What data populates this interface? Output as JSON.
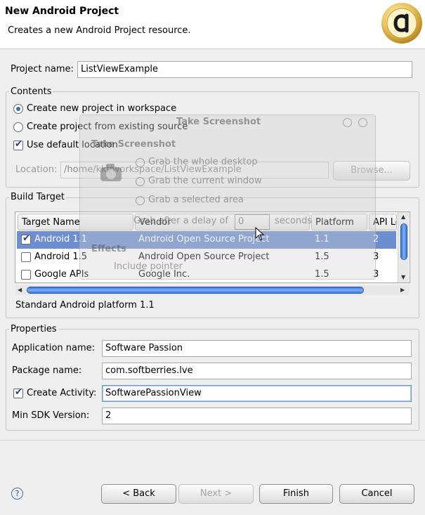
{
  "header": {
    "title": "New Android Project",
    "description": "Creates a new Android Project resource."
  },
  "project_name": {
    "label": "Project name:",
    "value": "ListViewExample"
  },
  "contents": {
    "title": "Contents",
    "create_new": "Create new project in workspace",
    "create_existing": "Create project from existing source",
    "use_default_location": "Use default location",
    "location_label": "Location:",
    "location_value": "/home/kkl/workspace/ListViewExample",
    "browse_label": "Browse..."
  },
  "build_target": {
    "title": "Build Target",
    "columns": [
      "Target Name",
      "Vendor",
      "Platform",
      "API Le"
    ],
    "rows": [
      {
        "checked": true,
        "selected": true,
        "name": "Android 1.1",
        "vendor": "Android Open Source Project",
        "platform": "1.1",
        "api": "2"
      },
      {
        "checked": false,
        "selected": false,
        "name": "Android 1.5",
        "vendor": "Android Open Source Project",
        "platform": "1.5",
        "api": "3"
      },
      {
        "checked": false,
        "selected": false,
        "name": "Google APIs",
        "vendor": "Google Inc.",
        "platform": "1.5",
        "api": "3"
      }
    ],
    "description": "Standard Android platform 1.1"
  },
  "properties": {
    "title": "Properties",
    "app_name_label": "Application name:",
    "app_name_value": "Software Passion",
    "package_label": "Package name:",
    "package_value": "com.softberries.lve",
    "create_activity_label": "Create Activity:",
    "create_activity_value": "SoftwarePassionView",
    "min_sdk_label": "Min SDK Version:",
    "min_sdk_value": "2"
  },
  "screenshot_overlay": {
    "window_title": "Take Screenshot",
    "heading": "Take Screenshot",
    "opt_desktop": "Grab the whole desktop",
    "opt_window": "Grab the current window",
    "opt_area": "Grab a selected area",
    "delay_prefix": "Grab after a delay of",
    "delay_value": "0",
    "delay_suffix": "seconds",
    "effects": "Effects",
    "include_pointer": "Include pointer"
  },
  "buttons": {
    "help": "?",
    "back": "< Back",
    "next": "Next >",
    "finish": "Finish",
    "cancel": "Cancel"
  },
  "colors": {
    "selection": "#6d8fcf",
    "scroll_thumb": "#3b77d8"
  }
}
